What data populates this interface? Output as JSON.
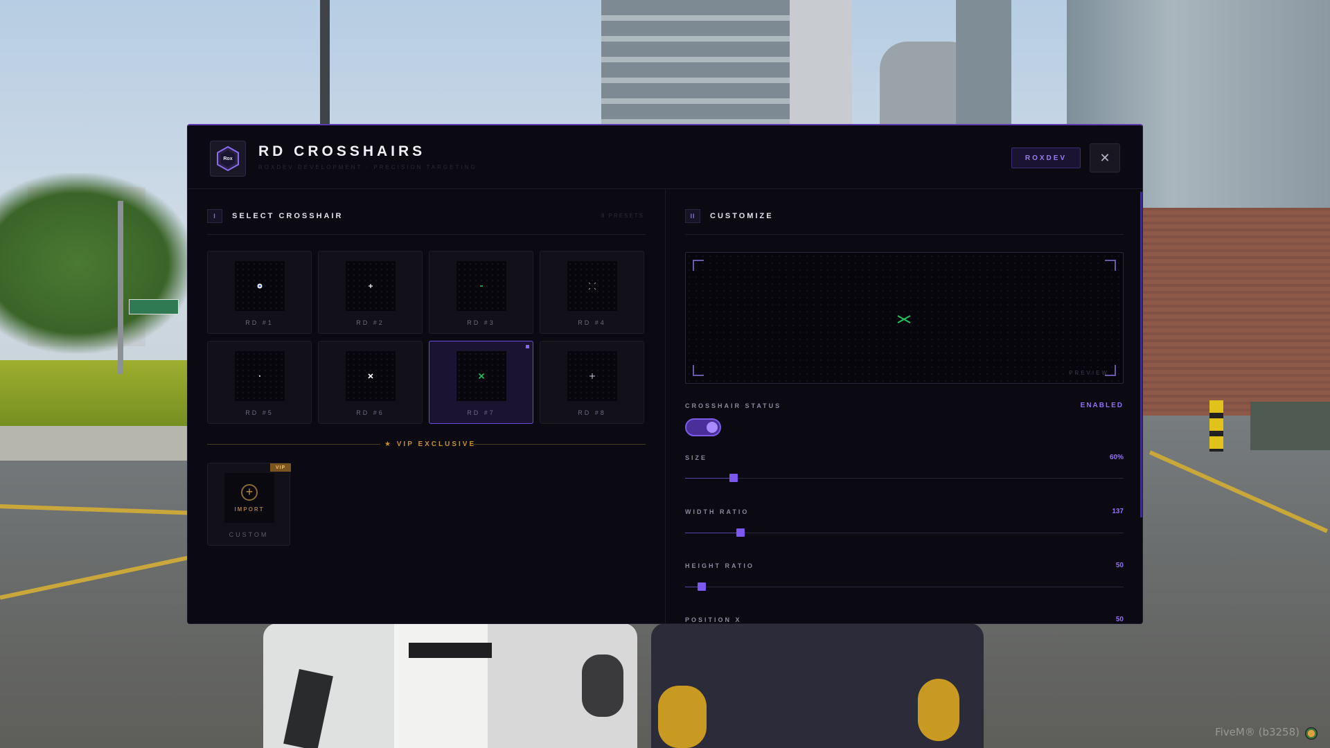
{
  "header": {
    "title": "RD CROSSHAIRS",
    "subtitle": "ROXDEV DEVELOPMENT · PRECISION TARGETING",
    "logo_text": "Rox",
    "brand_button": "ROXDEV",
    "close_symbol": "✕"
  },
  "select": {
    "number": "I",
    "title": "SELECT CROSSHAIR",
    "count": "8 PRESETS",
    "presets": [
      {
        "label": "RD #1",
        "icon": "dot-icon",
        "color": "#ffffff"
      },
      {
        "label": "RD #2",
        "icon": "small-plus-icon",
        "color": "#ffffff"
      },
      {
        "label": "RD #3",
        "icon": "green-dash-icon",
        "color": "#22c55e"
      },
      {
        "label": "RD #4",
        "icon": "spread-corners-icon",
        "color": "#9a98a8"
      },
      {
        "label": "RD #5",
        "icon": "tiny-dot-icon",
        "color": "#ffffff"
      },
      {
        "label": "RD #6",
        "icon": "x-cross-icon",
        "color": "#ffffff"
      },
      {
        "label": "RD #7",
        "icon": "green-x-icon",
        "color": "#22c55e"
      },
      {
        "label": "RD #8",
        "icon": "thin-plus-icon",
        "color": "#cfcde0"
      }
    ],
    "selected_index": 6
  },
  "vip": {
    "title": "★ VIP EXCLUSIVE",
    "badge": "VIP",
    "import_label": "IMPORT",
    "custom_label": "CUSTOM"
  },
  "customize": {
    "number": "II",
    "title": "CUSTOMIZE",
    "preview_label": "PREVIEW",
    "status_label": "CROSSHAIR STATUS",
    "status_value": "ENABLED",
    "size_label": "SIZE",
    "size_value": "60%",
    "width_label": "WIDTH RATIO",
    "width_value": "137",
    "height_label": "HEIGHT RATIO",
    "height_value": "50",
    "posx_label": "POSITION X",
    "posx_value": "50"
  },
  "colors": {
    "accent": "#7b58f0",
    "vip": "#c8922e",
    "panel_bg": "#0b0a12"
  },
  "watermark": "FiveM® (b3258)"
}
